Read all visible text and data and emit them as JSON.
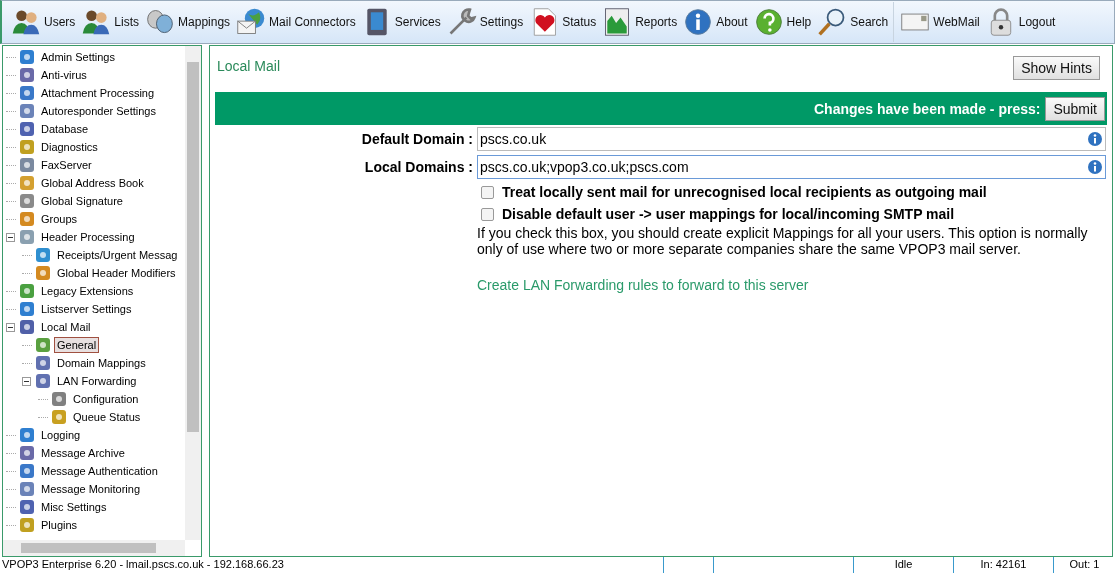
{
  "toolbar": [
    {
      "label": "Users"
    },
    {
      "label": "Lists"
    },
    {
      "label": "Mappings"
    },
    {
      "label": "Mail Connectors"
    },
    {
      "label": "Services"
    },
    {
      "label": "Settings"
    },
    {
      "label": "Status"
    },
    {
      "label": "Reports"
    },
    {
      "label": "About"
    },
    {
      "label": "Help"
    },
    {
      "label": "Search"
    },
    {
      "label": "WebMail"
    },
    {
      "label": "Logout"
    }
  ],
  "sidebar": {
    "items": [
      {
        "label": "Admin Settings",
        "selected": false
      },
      {
        "label": "Anti-virus",
        "selected": false
      },
      {
        "label": "Attachment Processing",
        "selected": false
      },
      {
        "label": "Autoresponder Settings",
        "selected": false
      },
      {
        "label": "Database",
        "selected": false
      },
      {
        "label": "Diagnostics",
        "selected": false
      },
      {
        "label": "FaxServer",
        "selected": false
      },
      {
        "label": "Global Address Book",
        "selected": false
      },
      {
        "label": "Global Signature",
        "selected": false
      },
      {
        "label": "Groups",
        "selected": false
      },
      {
        "label": "Header Processing",
        "selected": false,
        "expanded": true,
        "children": [
          {
            "label": "Receipts/Urgent Messag",
            "selected": false
          },
          {
            "label": "Global Header Modifiers",
            "selected": false
          }
        ]
      },
      {
        "label": "Legacy Extensions",
        "selected": false
      },
      {
        "label": "Listserver Settings",
        "selected": false
      },
      {
        "label": "Local Mail",
        "selected": false,
        "expanded": true,
        "children": [
          {
            "label": "General",
            "selected": true
          },
          {
            "label": "Domain Mappings",
            "selected": false
          },
          {
            "label": "LAN Forwarding",
            "selected": false,
            "expanded": true,
            "children": [
              {
                "label": "Configuration",
                "selected": false
              },
              {
                "label": "Queue Status",
                "selected": false
              }
            ]
          }
        ]
      },
      {
        "label": "Logging",
        "selected": false
      },
      {
        "label": "Message Archive",
        "selected": false
      },
      {
        "label": "Message Authentication",
        "selected": false
      },
      {
        "label": "Message Monitoring",
        "selected": false
      },
      {
        "label": "Misc Settings",
        "selected": false
      },
      {
        "label": "Plugins",
        "selected": false
      }
    ]
  },
  "page": {
    "title": "Local Mail",
    "hints_button": "Show Hints",
    "banner": {
      "text": "Changes have been made - press:",
      "button": "Submit"
    },
    "fields": [
      {
        "label": "Default Domain :",
        "value": "pscs.co.uk"
      },
      {
        "label": "Local Domains :",
        "value": "pscs.co.uk;vpop3.co.uk;pscs.com"
      }
    ],
    "options": [
      {
        "label": "Treat locally sent mail for unrecognised local recipients as outgoing mail",
        "checked": false
      },
      {
        "label": "Disable default user -> user mappings for local/incoming SMTP mail",
        "checked": false
      }
    ],
    "note": "If you check this box, you should create explicit Mappings for all your users. This option is normally only of use where two or more separate companies share the same VPOP3 mail server.",
    "link": "Create LAN Forwarding rules to forward to this server"
  },
  "status_bar": {
    "server": "VPOP3 Enterprise 6.20 - lmail.pscs.co.uk - 192.168.66.23",
    "state": "Idle",
    "incoming": "In: 42161",
    "outgoing": "Out: 1"
  }
}
